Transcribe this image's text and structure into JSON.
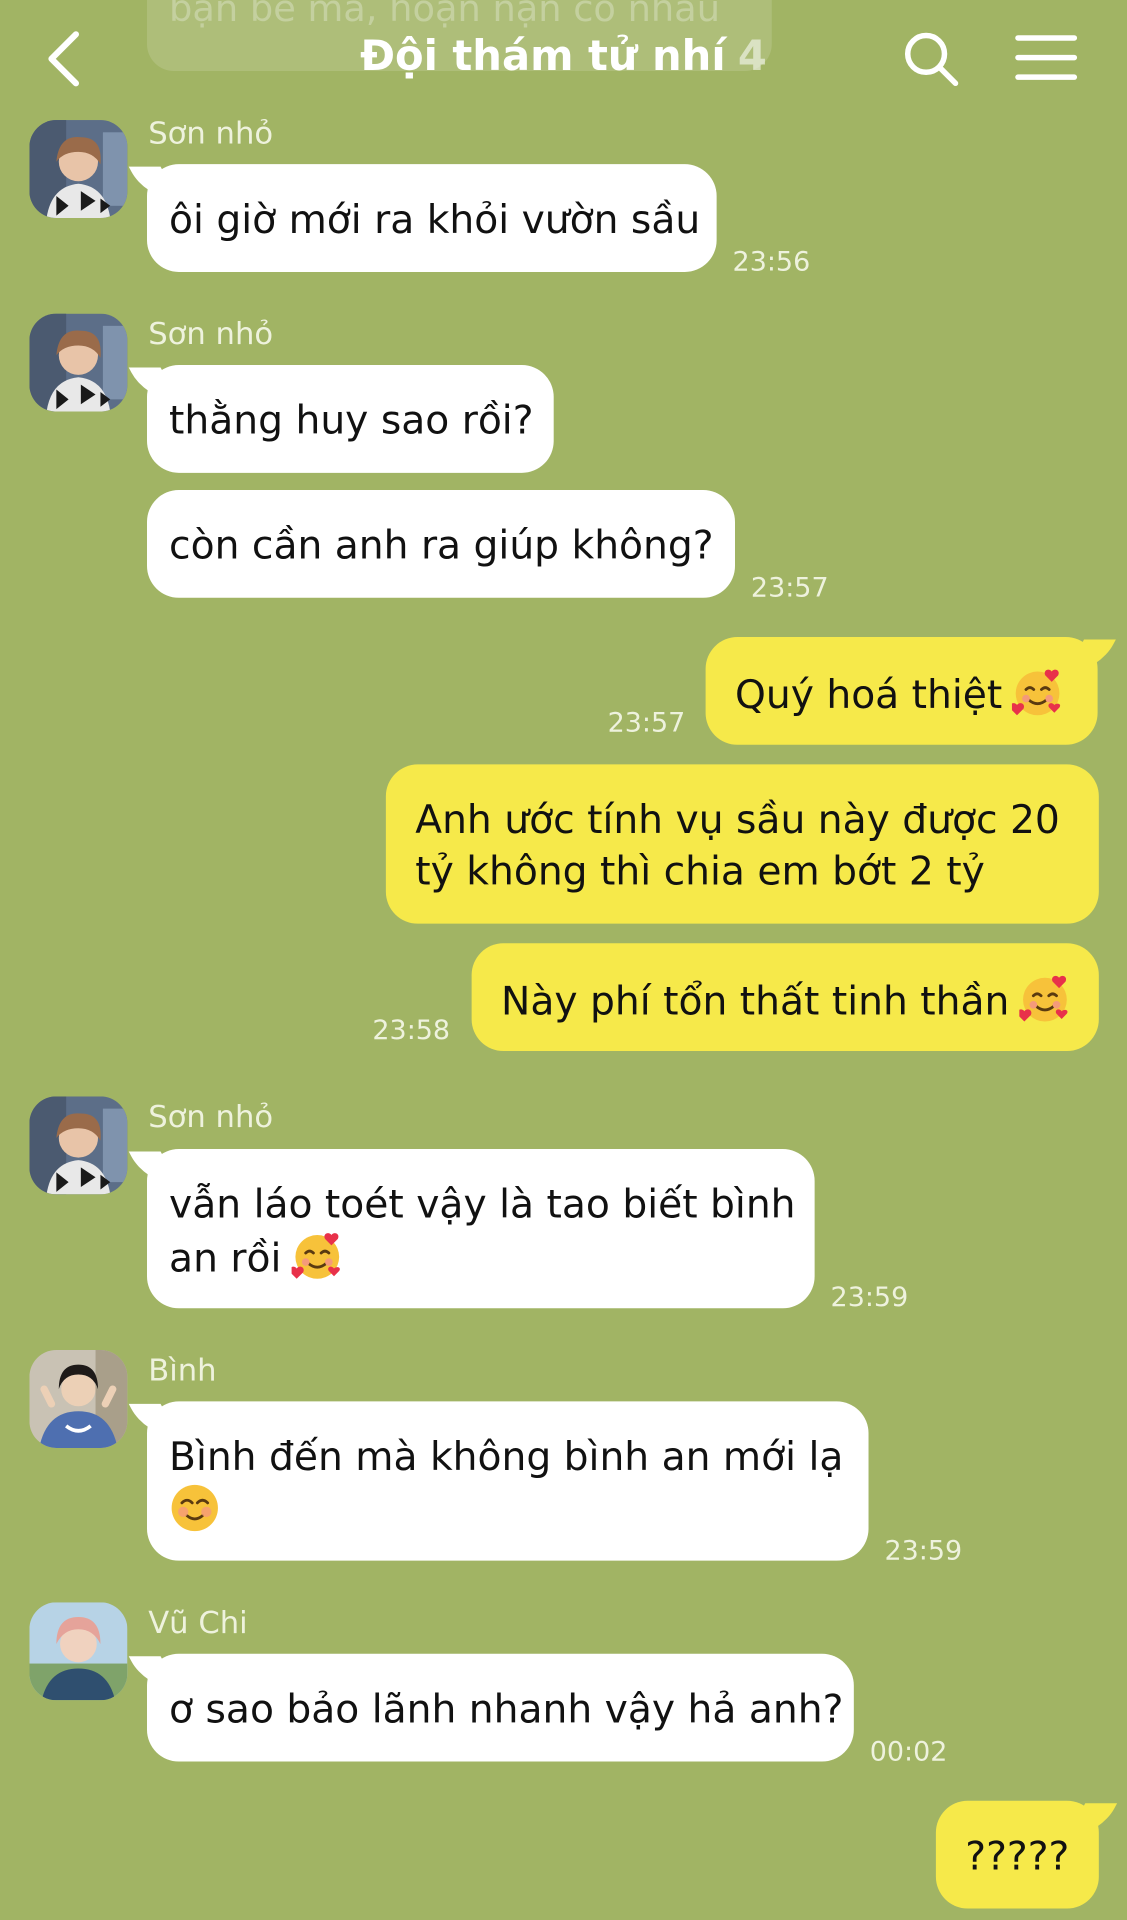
{
  "header": {
    "ghost_preview": "bạn bè mà, hoạn nạn có nhau",
    "title": "Đội thám tử nhí",
    "member_count": "4"
  },
  "colors": {
    "background": "#a1b464",
    "incoming_bubble": "#ffffff",
    "outgoing_bubble": "#f6e94a",
    "meta_text": "#eef2dd"
  },
  "icons": {
    "back": "chevron-left-icon",
    "search": "search-icon",
    "menu": "hamburger-menu-icon",
    "emoji": "smiling-face-with-hearts-icon",
    "emoji_blush": "smiling-face-icon"
  },
  "messages": [
    {
      "sender": "Sơn nhỏ",
      "lines": [
        "ôi giờ mới ra khỏi vườn sầu"
      ],
      "time": "23:56"
    },
    {
      "sender": "Sơn nhỏ",
      "lines": [
        "thằng huy sao rồi?"
      ]
    },
    {
      "lines": [
        "còn cần anh ra giúp không?"
      ],
      "time": "23:57"
    },
    {
      "outgoing": true,
      "lines": [
        "Quý hoá thiệt"
      ],
      "time": "23:57"
    },
    {
      "outgoing": true,
      "lines": [
        "Anh ước tính vụ sầu này được 20",
        "tỷ không thì chia em bớt 2 tỷ"
      ]
    },
    {
      "outgoing": true,
      "lines": [
        "Này phí tổn thất tinh thần"
      ],
      "time": "23:58"
    },
    {
      "sender": "Sơn nhỏ",
      "lines": [
        "vẫn láo toét vậy là tao biết bình",
        "an rồi"
      ],
      "time": "23:59"
    },
    {
      "sender": "Bình",
      "lines": [
        "Bình đến mà không bình an mới lạ"
      ],
      "time": "23:59"
    },
    {
      "sender": "Vũ Chi",
      "lines": [
        "ơ sao bảo lãnh nhanh vậy hả anh?"
      ],
      "time": "00:02"
    },
    {
      "outgoing": true,
      "lines": [
        "?????"
      ]
    }
  ]
}
